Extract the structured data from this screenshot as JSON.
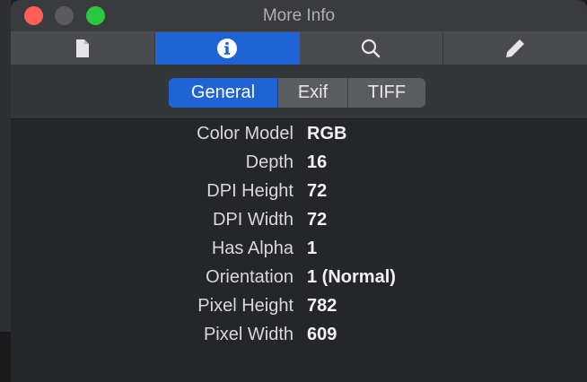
{
  "window": {
    "title": "More Info",
    "traffic_colors": {
      "close": "#ff5f57",
      "minimize": "#5b5b5e",
      "zoom": "#28c840"
    }
  },
  "toolbar": {
    "items": [
      {
        "icon": "document-icon",
        "name": "File"
      },
      {
        "icon": "info-icon",
        "name": "Info",
        "active": true
      },
      {
        "icon": "search-icon",
        "name": "Search"
      },
      {
        "icon": "pencil-icon",
        "name": "Edit"
      }
    ],
    "accent": "#1f63d6"
  },
  "tabs": [
    {
      "label": "General",
      "active": true
    },
    {
      "label": "Exif",
      "active": false
    },
    {
      "label": "TIFF",
      "active": false
    }
  ],
  "properties": [
    {
      "key": "Color Model",
      "value": "RGB"
    },
    {
      "key": "Depth",
      "value": "16"
    },
    {
      "key": "DPI Height",
      "value": "72"
    },
    {
      "key": "DPI Width",
      "value": "72"
    },
    {
      "key": "Has Alpha",
      "value": "1"
    },
    {
      "key": "Orientation",
      "value": "1 (Normal)"
    },
    {
      "key": "Pixel Height",
      "value": "782"
    },
    {
      "key": "Pixel Width",
      "value": "609"
    }
  ]
}
